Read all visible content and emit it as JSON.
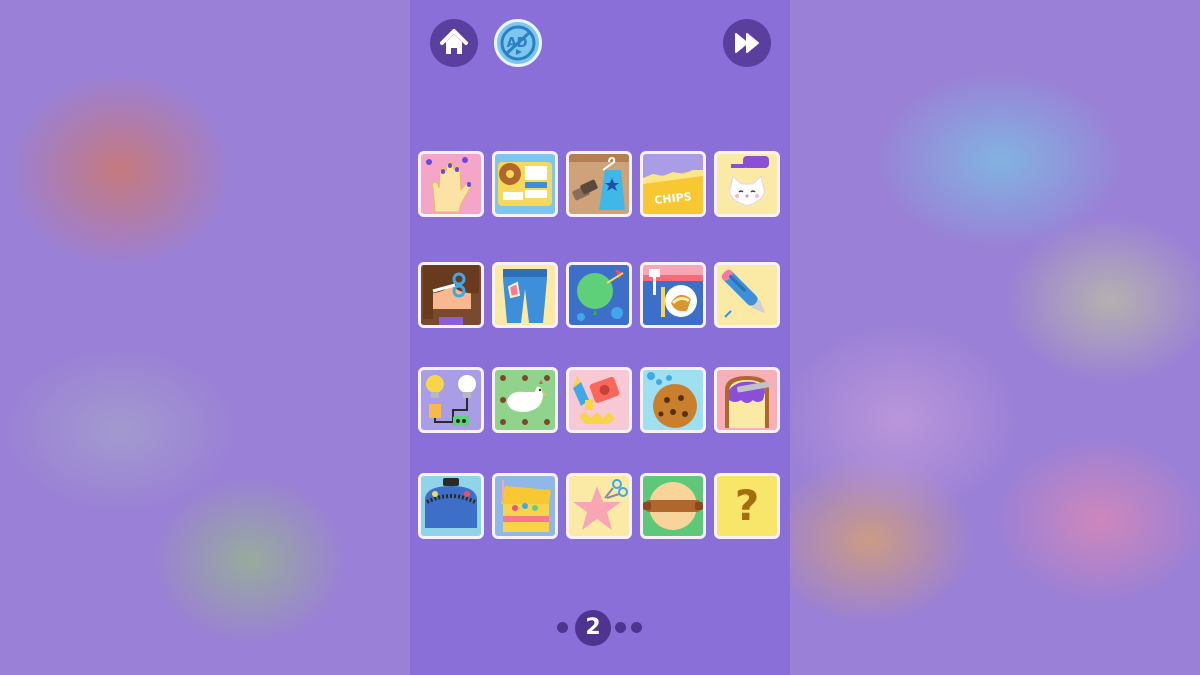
{
  "colors": {
    "panel": "#8b6fd9",
    "button_dark": "#5b3f9f",
    "noads_button": "#7ec6ee",
    "tile_border": "#f6f1fb",
    "pager": "#4e348f"
  },
  "top_bar": {
    "home_icon": "house-icon",
    "noads_label": "AD",
    "noads_icon": "no-ads-icon",
    "skip_icon": "fast-forward-icon"
  },
  "level_grid": {
    "tiles": [
      {
        "icon": "nail-painting-hand-icon"
      },
      {
        "icon": "lunchbox-donut-icon"
      },
      {
        "icon": "clothes-tag-dress-icon"
      },
      {
        "icon": "chips-bag-icon",
        "label": "CHIPS"
      },
      {
        "icon": "cat-brush-icon"
      },
      {
        "icon": "hair-cut-scissors-icon"
      },
      {
        "icon": "jeans-patch-icon"
      },
      {
        "icon": "balloon-pop-icon"
      },
      {
        "icon": "sandwich-plate-icon"
      },
      {
        "icon": "pen-icon"
      },
      {
        "icon": "light-bulb-battery-icon"
      },
      {
        "icon": "chicken-icon"
      },
      {
        "icon": "pencil-sharpener-icon"
      },
      {
        "icon": "cookie-icon"
      },
      {
        "icon": "toast-jam-icon"
      },
      {
        "icon": "zipper-lunchbox-icon"
      },
      {
        "icon": "treasure-chest-icon"
      },
      {
        "icon": "star-scissors-icon"
      },
      {
        "icon": "rolling-pin-dough-icon"
      },
      {
        "icon": "question-mark-icon",
        "label": "?"
      }
    ]
  },
  "pager": {
    "current_page": "2",
    "total_dots": 4
  }
}
